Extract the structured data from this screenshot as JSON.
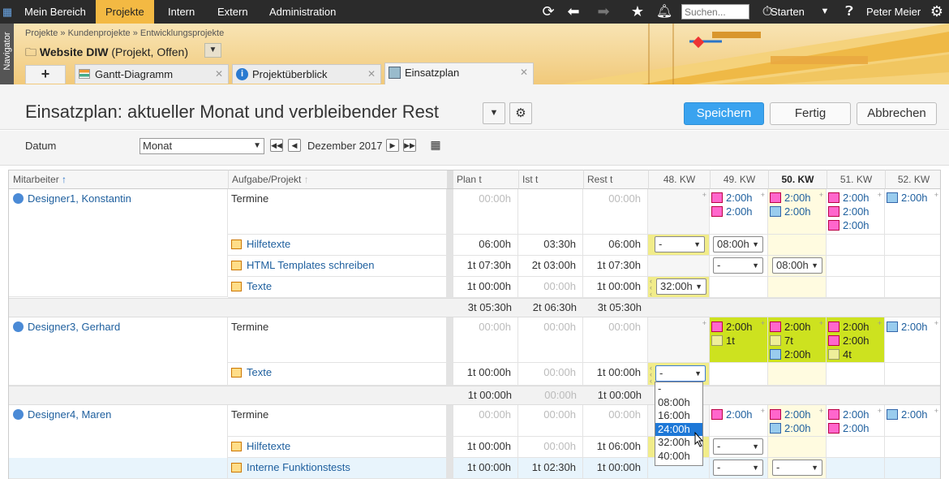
{
  "topnav": {
    "items": [
      "Mein Bereich",
      "Projekte",
      "Intern",
      "Extern",
      "Administration"
    ],
    "active": "Projekte",
    "search_placeholder": "Suchen...",
    "start_label": "Starten",
    "user": "Peter Meier"
  },
  "navigator_label": "Navigator",
  "breadcrumb": [
    "Projekte",
    "Kundenprojekte",
    "Entwicklungsprojekte"
  ],
  "project": {
    "name": "Website DIW",
    "status": "(Projekt, Offen)"
  },
  "tabs": [
    {
      "label": "Gantt-Diagramm"
    },
    {
      "label": "Projektüberblick"
    },
    {
      "label": "Einsatzplan",
      "active": true
    }
  ],
  "page_title": "Einsatzplan: aktueller Monat und verbleibender Rest",
  "buttons": {
    "save": "Speichern",
    "done": "Fertig",
    "cancel": "Abbrechen"
  },
  "filter": {
    "datum_label": "Datum",
    "period": "Monat",
    "month": "Dezember 2017"
  },
  "columns": {
    "employee": "Mitarbeiter",
    "task": "Aufgabe/Projekt",
    "plan": "Plan t",
    "actual": "Ist t",
    "rest": "Rest t",
    "weeks": [
      "48. KW",
      "49. KW",
      "50. KW",
      "51. KW",
      "52. KW"
    ]
  },
  "rows": [
    {
      "employee": "Designer1, Konstantin",
      "task": "Termine",
      "plan": "00:00h",
      "actual": "",
      "rest": "00:00h",
      "w49": [
        "2:00h",
        "2:00h"
      ],
      "w50": [
        "2:00h",
        "2:00h"
      ],
      "w51": [
        "2:00h",
        "2:00h",
        "2:00h"
      ],
      "w52": [
        "2:00h"
      ]
    },
    {
      "task": "Hilfetexte",
      "plan": "06:00h",
      "actual": "03:30h",
      "rest": "06:00h",
      "w48": "-",
      "w49": "08:00h"
    },
    {
      "task": "HTML Templates schreiben",
      "plan": "1t 07:30h",
      "actual": "2t 03:00h",
      "rest": "1t 07:30h",
      "w49": "-",
      "w50": "08:00h"
    },
    {
      "task": "Texte",
      "plan": "1t 00:00h",
      "actual": "00:00h",
      "rest": "1t 00:00h",
      "w48": "32:00h"
    },
    {
      "sum_plan": "3t 05:30h",
      "sum_actual": "2t 06:30h",
      "sum_rest": "3t 05:30h"
    },
    {
      "employee": "Designer3, Gerhard",
      "task": "Termine",
      "plan": "00:00h",
      "actual": "00:00h",
      "rest": "00:00h",
      "w49": [
        "2:00h",
        "1t"
      ],
      "w50": [
        "2:00h",
        "7t",
        "2:00h"
      ],
      "w51": [
        "2:00h",
        "2:00h",
        "4t"
      ],
      "w52": [
        "2:00h"
      ]
    },
    {
      "task": "Texte",
      "plan": "1t 00:00h",
      "actual": "00:00h",
      "rest": "1t 00:00h",
      "w48": "-"
    },
    {
      "sum_plan": "1t 00:00h",
      "sum_actual": "00:00h",
      "sum_rest": "1t 00:00h"
    },
    {
      "employee": "Designer4, Maren",
      "task": "Termine",
      "plan": "00:00h",
      "actual": "00:00h",
      "rest": "00:00h",
      "w49": [
        "2:00h"
      ],
      "w50": [
        "2:00h",
        "2:00h"
      ],
      "w51": [
        "2:00h",
        "2:00h"
      ],
      "w52": [
        "2:00h"
      ]
    },
    {
      "task": "Hilfetexte",
      "plan": "1t 00:00h",
      "actual": "00:00h",
      "rest": "1t 06:00h",
      "w49": "-"
    },
    {
      "task": "Interne Funktionstests",
      "plan": "1t 00:00h",
      "actual": "1t 02:30h",
      "rest": "1t 00:00h",
      "w49": "-",
      "w50": "-"
    }
  ],
  "dropdown_options": [
    "-",
    "08:00h",
    "16:00h",
    "24:00h",
    "32:00h",
    "40:00h"
  ],
  "dropdown_selected": "24:00h"
}
